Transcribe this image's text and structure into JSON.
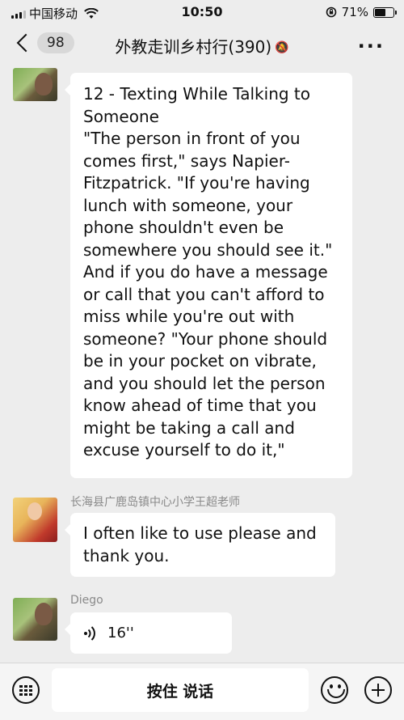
{
  "status_bar": {
    "carrier": "中国移动",
    "time": "10:50",
    "battery": "71%",
    "battery_level": 0.71
  },
  "nav": {
    "back_count": "98",
    "title": "外教走训乡村行(390)"
  },
  "messages": [
    {
      "lines": [
        "12 - Texting While Talking to Someone",
        "\"The person in front of you comes first,\" says Napier-Fitzpatrick. \"If you're having lunch with someone, your phone shouldn't even be somewhere you should see it.\" And if you do have a message or call that you can't afford to miss while you're out with someone? \"Your phone should be in your pocket on vibrate, and you should let the person know ahead of time that you might be taking a call and excuse yourself to do it,\""
      ]
    },
    {
      "sender": "长海县广鹿岛镇中心小学王超老师",
      "text": "I often like to use please and thank you."
    },
    {
      "sender": "Diego",
      "voice_duration": "16''"
    }
  ],
  "input_bar": {
    "hold_to_talk": "按住 说话"
  }
}
